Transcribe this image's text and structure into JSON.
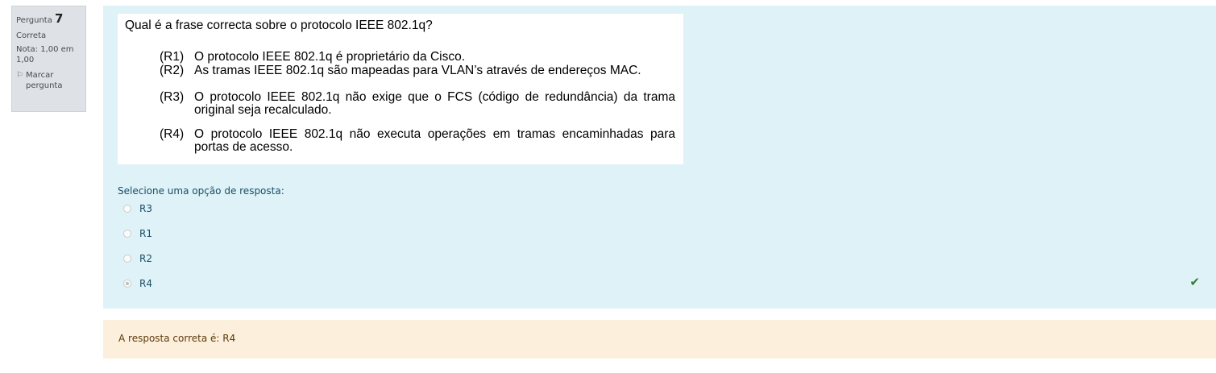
{
  "info": {
    "question_label": "Pergunta",
    "question_number": "7",
    "state": "Correta",
    "grade": "Nota: 1,00 em 1,00",
    "flag_label": "Marcar pergunta",
    "flag_icon": "flag-icon"
  },
  "question": {
    "title": "Qual é a frase correcta sobre o protocolo IEEE 802.1q?",
    "statements": [
      {
        "tag": "(R1)",
        "text": "O protocolo IEEE 802.1q é proprietário da Cisco."
      },
      {
        "tag": "(R2)",
        "text": "As tramas IEEE 802.1q são mapeadas para VLAN’s através de endereços MAC."
      },
      {
        "tag": "(R3)",
        "text": "O protocolo IEEE 802.1q não exige que o FCS (código de redundância) da trama original seja recalculado."
      },
      {
        "tag": "(R4)",
        "text": "O protocolo IEEE 802.1q não executa operações em tramas encaminhadas para portas de acesso."
      }
    ]
  },
  "answer": {
    "prompt": "Selecione uma opção de resposta:",
    "options": [
      {
        "label": "R3",
        "checked": false
      },
      {
        "label": "R1",
        "checked": false
      },
      {
        "label": "R2",
        "checked": false
      },
      {
        "label": "R4",
        "checked": true
      }
    ],
    "correct_icon": "check-icon"
  },
  "feedback": {
    "text": "A resposta correta é: R4"
  },
  "colors": {
    "formulation_bg": "#def2f8",
    "feedback_bg": "#fcefdc",
    "info_bg": "#dee2e6",
    "correct": "#357a32"
  }
}
